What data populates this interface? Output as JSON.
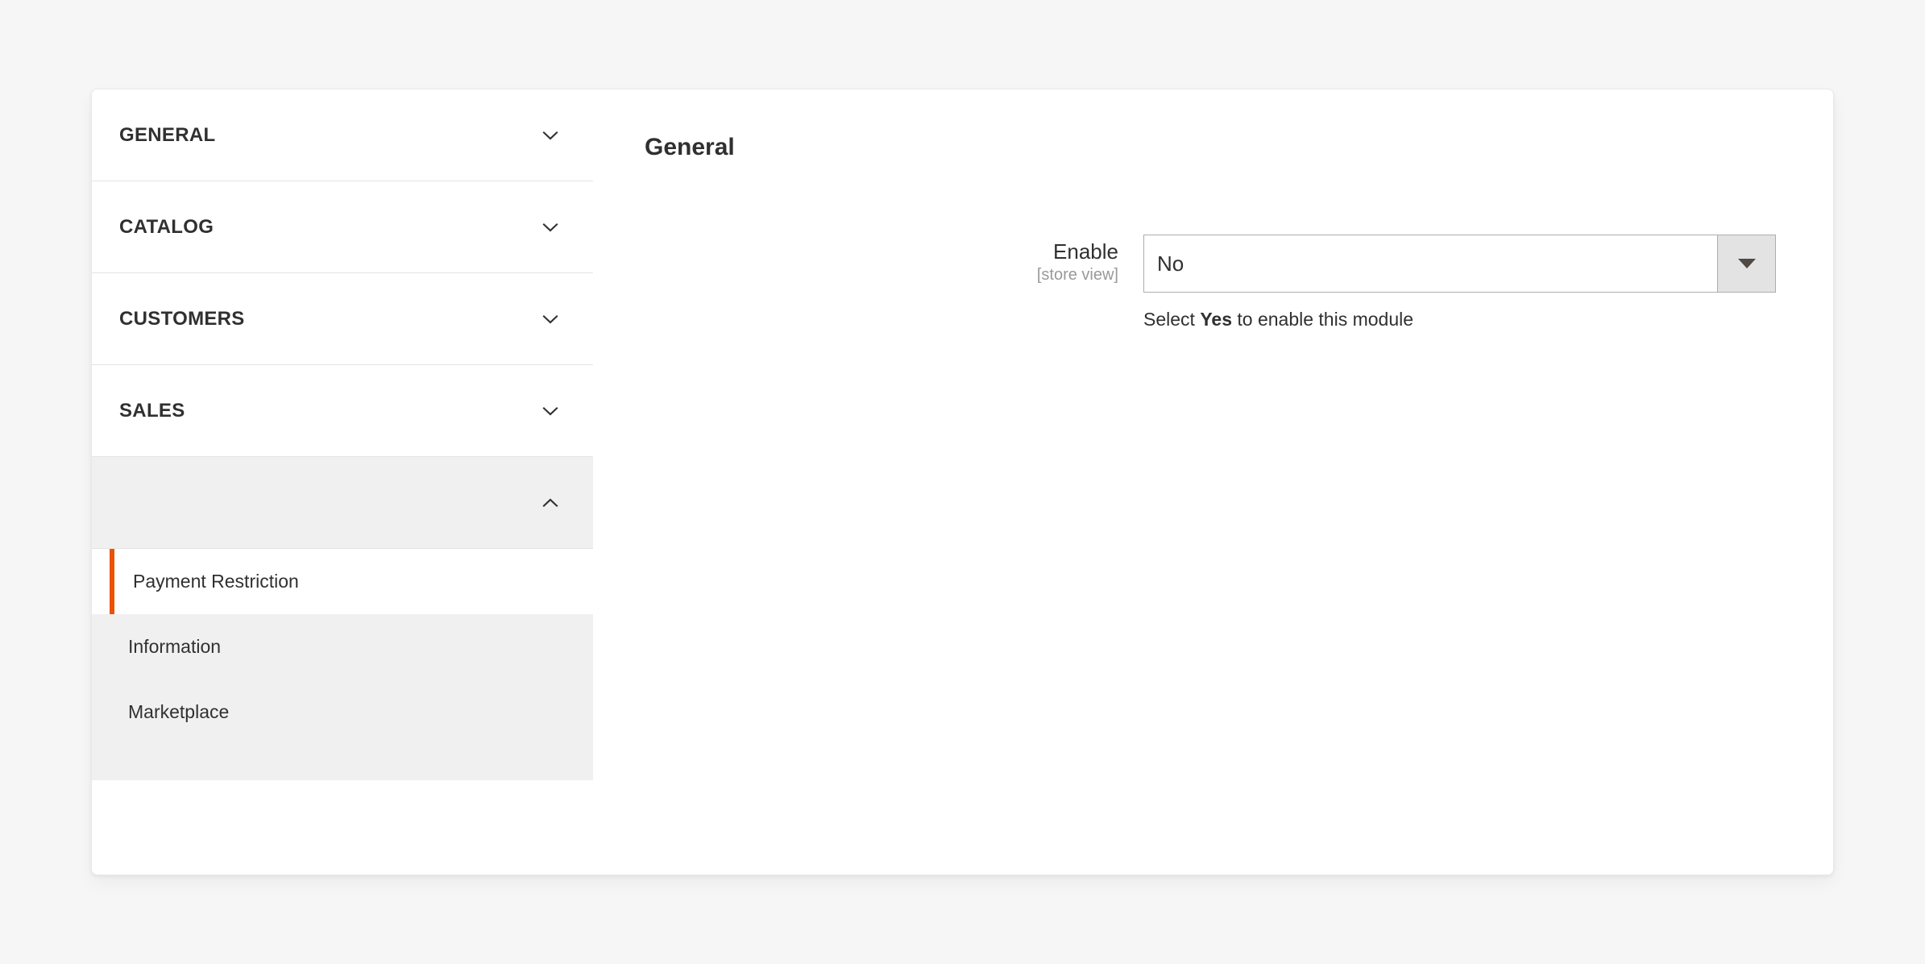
{
  "sidebar": {
    "sections": [
      {
        "label": "GENERAL",
        "icon": "chevron-down-icon",
        "open": false
      },
      {
        "label": "CATALOG",
        "icon": "chevron-down-icon",
        "open": false
      },
      {
        "label": "CUSTOMERS",
        "icon": "chevron-down-icon",
        "open": false
      },
      {
        "label": "SALES",
        "icon": "chevron-down-icon",
        "open": false
      },
      {
        "label": "",
        "icon": "chevron-up-icon",
        "open": true
      }
    ],
    "items": [
      {
        "label": "Payment Restriction",
        "active": true
      },
      {
        "label": "Information",
        "active": false
      },
      {
        "label": "Marketplace",
        "active": false
      }
    ]
  },
  "content": {
    "title": "General",
    "field": {
      "label": "Enable",
      "scope": "[store view]",
      "value": "No",
      "options": [
        "Yes",
        "No"
      ],
      "note_prefix": "Select ",
      "note_strong": "Yes",
      "note_suffix": " to enable this module",
      "dropdown_icon": "caret-down-icon"
    }
  },
  "colors": {
    "accent": "#eb5202",
    "page_background": "#f6f6f6",
    "panel_background": "#ffffff",
    "subnav_background": "#f0f0f0",
    "text": "#303030",
    "muted_text": "#999999",
    "border": "#e3e3e3",
    "input_border": "#adadad"
  }
}
